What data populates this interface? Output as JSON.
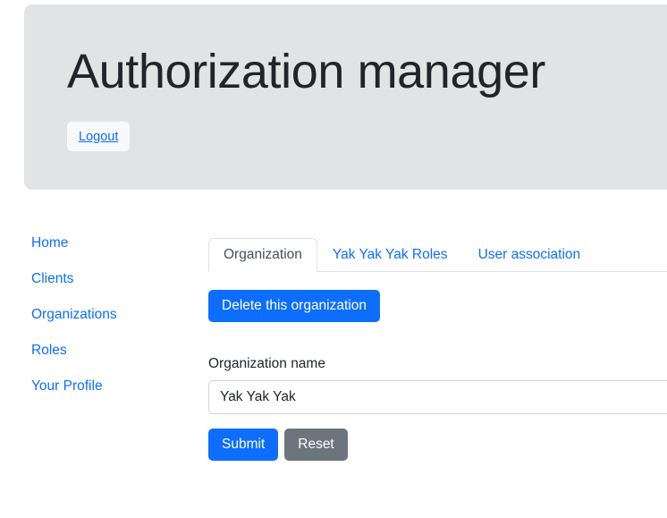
{
  "header": {
    "title": "Authorization manager",
    "logout_label": "Logout"
  },
  "sidebar": {
    "items": [
      {
        "label": "Home"
      },
      {
        "label": "Clients"
      },
      {
        "label": "Organizations"
      },
      {
        "label": "Roles"
      },
      {
        "label": "Your Profile"
      }
    ]
  },
  "main": {
    "tabs": [
      {
        "label": "Organization",
        "active": true
      },
      {
        "label": "Yak Yak Yak Roles",
        "active": false
      },
      {
        "label": "User association",
        "active": false
      }
    ],
    "delete_button_label": "Delete this organization",
    "form": {
      "name_label": "Organization name",
      "name_value": "Yak Yak Yak",
      "name_placeholder": "",
      "submit_label": "Submit",
      "reset_label": "Reset"
    }
  },
  "colors": {
    "primary": "#0d6efd",
    "secondary": "#6c757d",
    "jumbotron_bg": "#e2e3e5",
    "text": "#212529",
    "border": "#dee2e6"
  }
}
